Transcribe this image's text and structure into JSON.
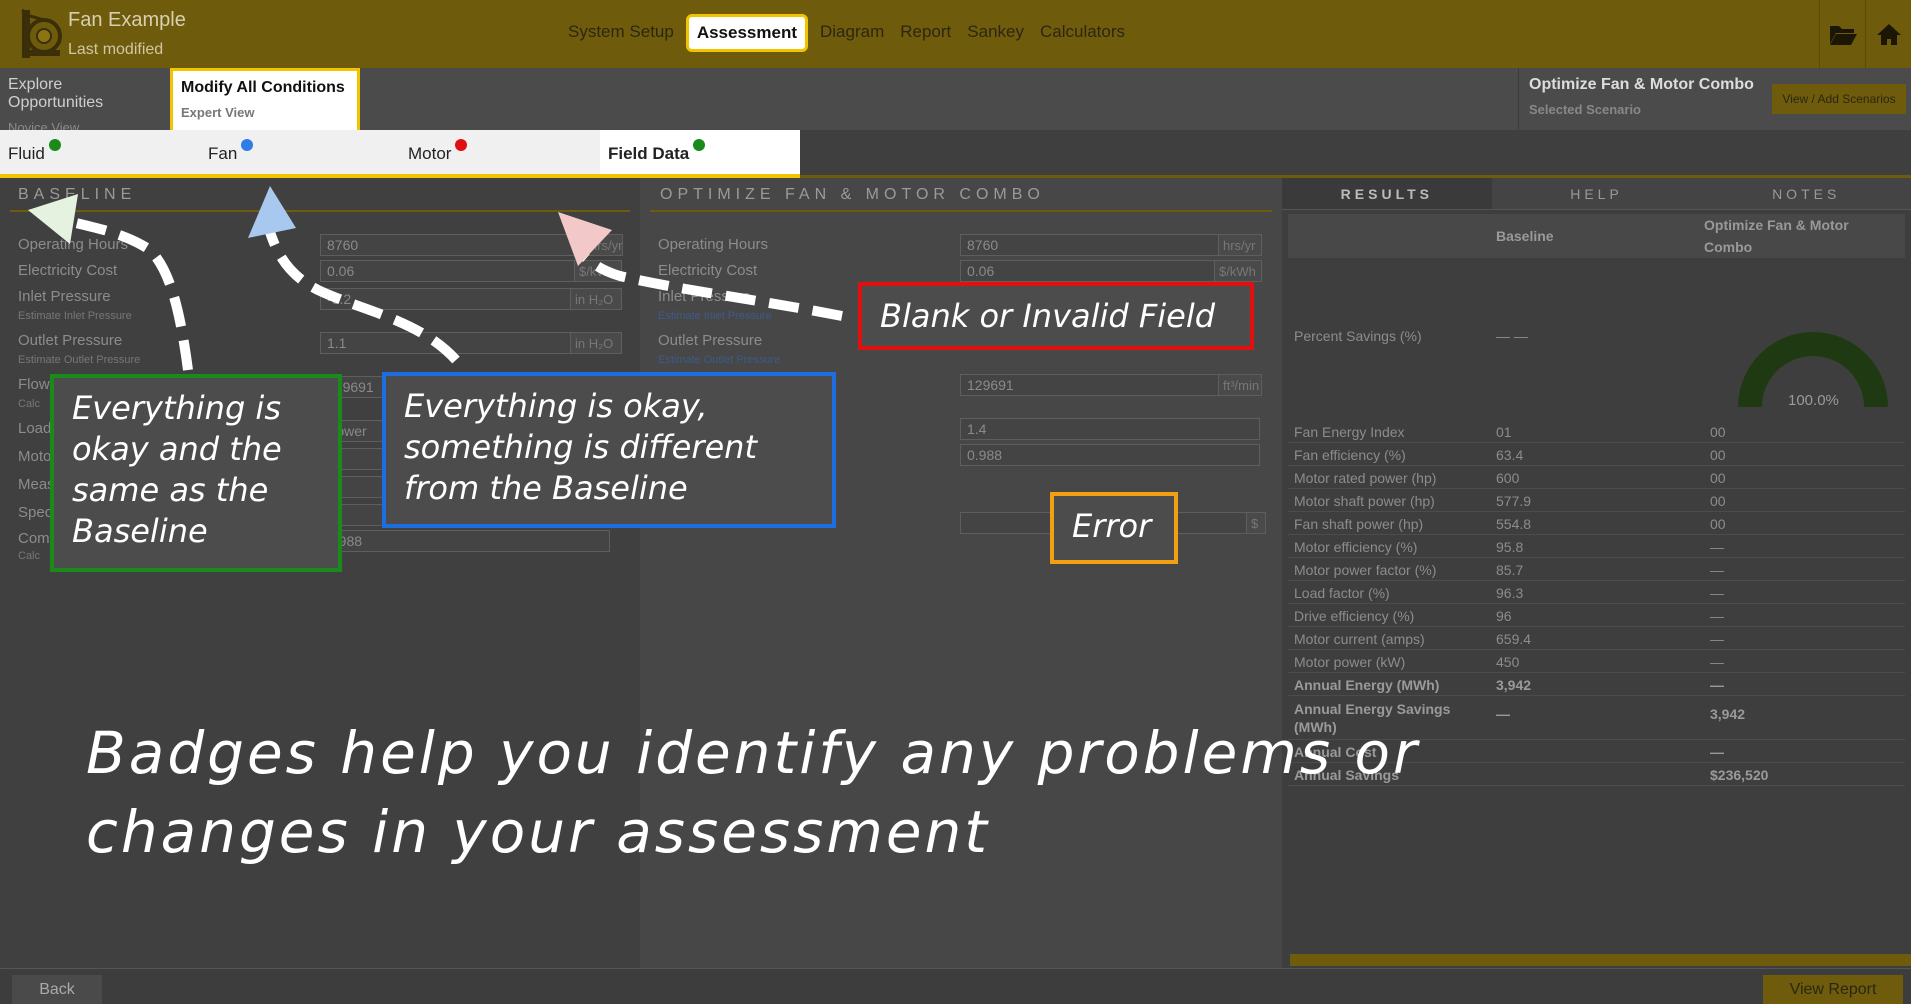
{
  "app": {
    "title": "Fan Example",
    "subtitle": "Last modified"
  },
  "nav": [
    {
      "label": "System Setup",
      "active": false
    },
    {
      "label": "Assessment",
      "active": true
    },
    {
      "label": "Diagram",
      "active": false
    },
    {
      "label": "Report",
      "active": false
    },
    {
      "label": "Sankey",
      "active": false
    },
    {
      "label": "Calculators",
      "active": false
    }
  ],
  "view_tabs": [
    {
      "label": "Explore Opportunities",
      "sub": "Novice View"
    },
    {
      "label": "Modify All Conditions",
      "sub": "Expert View"
    }
  ],
  "scenario": {
    "name": "Optimize Fan & Motor Combo",
    "label": "Selected Scenario",
    "button": "View / Add Scenarios"
  },
  "condition_tabs": [
    {
      "label": "Fluid",
      "badge": "#1a8a1a"
    },
    {
      "label": "Fan",
      "badge": "#2f7de8"
    },
    {
      "label": "Motor",
      "badge": "#e01010"
    },
    {
      "label": "Field Data",
      "badge": "#1a8a1a"
    }
  ],
  "baseline": {
    "heading": "BASELINE",
    "labels": {
      "hours": "Operating Hours",
      "cost": "Electricity Cost",
      "inlet": "Inlet Pressure",
      "inlet_link": "Estimate Inlet Pressure",
      "outlet": "Outlet Pressure",
      "outlet_link": "Estimate Outlet Pressure",
      "flow": "Flow Rate",
      "load": "Load",
      "motor": "Motor",
      "meas": "Meas",
      "spec": "Spec",
      "comp": "Comp",
      "calc": "Calc"
    },
    "values": {
      "hours": "8760",
      "cost": "0.06",
      "inlet": "-0.2",
      "outlet": "1.1",
      "flow": "129691",
      "comp": "0.988"
    },
    "units": {
      "hours": "hrs/yr",
      "cost": "$/kWh",
      "inlet": "in H₂O",
      "outlet": "in H₂O",
      "load": "Power"
    }
  },
  "modified": {
    "heading": "OPTIMIZE FAN & MOTOR COMBO",
    "labels": {
      "hours": "Operating Hours",
      "cost": "Electricity Cost",
      "inlet": "Inlet Pressure",
      "inlet_link": "Estimate Inlet Pressure",
      "outlet": "Outlet Pressure",
      "outlet_link": "Estimate Outlet Pressure"
    },
    "values": {
      "hours": "8760",
      "cost": "0.06",
      "flow": "129691",
      "v1": "1.4",
      "v2": "0.988",
      "empty": ""
    },
    "units": {
      "hours": "hrs/yr",
      "cost": "$/kWh",
      "flow": "ft³/min",
      "dollar": "$"
    }
  },
  "results": {
    "tabs": [
      "RESULTS",
      "HELP",
      "NOTES"
    ],
    "col_baseline": "Baseline",
    "col_modified": "Optimize Fan & Motor Combo",
    "percent_label": "Percent Savings (%)",
    "percent_baseline": "— —",
    "gauge_value": "100.0%",
    "gauge_fraction": 1.0,
    "rows": [
      {
        "label": "Fan Energy Index",
        "baseline": "01",
        "modified": "00",
        "bold": false
      },
      {
        "label": "Fan efficiency (%)",
        "baseline": "63.4",
        "modified": "00",
        "bold": false
      },
      {
        "label": "Motor rated power (hp)",
        "baseline": "600",
        "modified": "00",
        "bold": false
      },
      {
        "label": "Motor shaft power (hp)",
        "baseline": "577.9",
        "modified": "00",
        "bold": false
      },
      {
        "label": "Fan shaft power (hp)",
        "baseline": "554.8",
        "modified": "00",
        "bold": false
      },
      {
        "label": "Motor efficiency (%)",
        "baseline": "95.8",
        "modified": "—",
        "bold": false
      },
      {
        "label": "Motor power factor (%)",
        "baseline": "85.7",
        "modified": "—",
        "bold": false
      },
      {
        "label": "Load factor (%)",
        "baseline": "96.3",
        "modified": "—",
        "bold": false
      },
      {
        "label": "Drive efficiency (%)",
        "baseline": "96",
        "modified": "—",
        "bold": false
      },
      {
        "label": "Motor current (amps)",
        "baseline": "659.4",
        "modified": "—",
        "bold": false
      },
      {
        "label": "Motor power (kW)",
        "baseline": "450",
        "modified": "—",
        "bold": false
      },
      {
        "label": "Annual Energy (MWh)",
        "baseline": "3,942",
        "modified": "—",
        "bold": true
      }
    ],
    "savings_label": "Annual Energy Savings (MWh)",
    "savings_baseline": "—",
    "savings_modified": "3,942",
    "cost_label": "Annual Cost",
    "cost_modified": "—",
    "annual_savings_label": "Annual Savings",
    "annual_savings_modified": "$236,520"
  },
  "callouts": {
    "green": "Everything is okay and the same as the Baseline",
    "blue": "Everything is okay, something is different from the Baseline",
    "red": "Blank or Invalid Field",
    "orange": "Error"
  },
  "caption": "Badges help you identify any problems or changes in your assessment",
  "buttons": {
    "back": "Back",
    "report": "View Report"
  },
  "colors": {
    "accent": "#f2c400",
    "topbar": "#6e5c0c",
    "green": "#1a8a1a",
    "blue": "#2f7de8",
    "red": "#e01010",
    "orange": "#f0a010"
  }
}
